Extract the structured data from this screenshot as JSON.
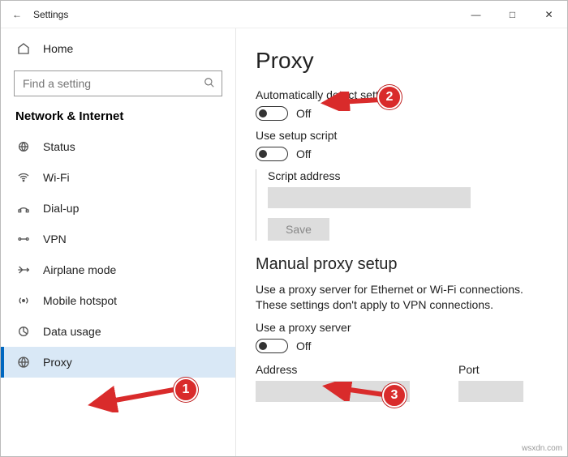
{
  "titlebar": {
    "title": "Settings",
    "minimize": "—",
    "maximize": "□",
    "close": "✕",
    "back": "←"
  },
  "sidebar": {
    "home_label": "Home",
    "search_placeholder": "Find a setting",
    "category": "Network & Internet",
    "items": [
      {
        "label": "Status",
        "iconName": "status-icon"
      },
      {
        "label": "Wi-Fi",
        "iconName": "wifi-icon"
      },
      {
        "label": "Dial-up",
        "iconName": "dialup-icon"
      },
      {
        "label": "VPN",
        "iconName": "vpn-icon"
      },
      {
        "label": "Airplane mode",
        "iconName": "airplane-icon"
      },
      {
        "label": "Mobile hotspot",
        "iconName": "hotspot-icon"
      },
      {
        "label": "Data usage",
        "iconName": "data-usage-icon"
      },
      {
        "label": "Proxy",
        "iconName": "proxy-icon"
      }
    ],
    "selectedIndex": 7
  },
  "main": {
    "title": "Proxy",
    "auto_detect_label": "Automatically detect settings",
    "auto_detect_state": "Off",
    "setup_script_label": "Use setup script",
    "setup_script_state": "Off",
    "script_address_label": "Script address",
    "save_label": "Save",
    "manual_heading": "Manual proxy setup",
    "manual_desc": "Use a proxy server for Ethernet or Wi-Fi connections. These settings don't apply to VPN connections.",
    "use_proxy_label": "Use a proxy server",
    "use_proxy_state": "Off",
    "address_label": "Address",
    "port_label": "Port"
  },
  "annotations": {
    "m1": "1",
    "m2": "2",
    "m3": "3"
  },
  "watermark": "wsxdn.com"
}
